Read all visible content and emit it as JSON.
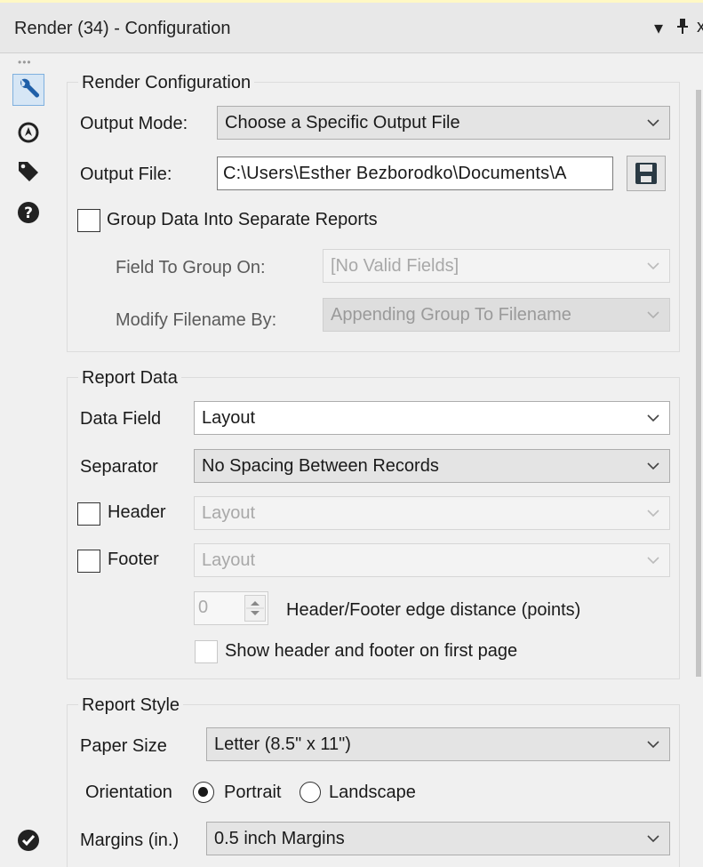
{
  "window": {
    "title": "Render (34) - Configuration",
    "pin_glyph": "▾ ⊥"
  },
  "tools": [
    {
      "icon": "wrench-icon",
      "active": true
    },
    {
      "icon": "compass-icon",
      "active": false
    },
    {
      "icon": "tag-icon",
      "active": false
    },
    {
      "icon": "help-icon",
      "active": false
    }
  ],
  "render_config": {
    "title": "Render Configuration",
    "output_mode_label": "Output Mode:",
    "output_mode_value": "Choose a Specific Output File",
    "output_file_label": "Output File:",
    "output_file_value": "C:\\Users\\Esther Bezborodko\\Documents\\A",
    "group_data_label": "Group Data Into Separate Reports",
    "field_to_group_label": "Field To Group On:",
    "field_to_group_value": "[No Valid Fields]",
    "modify_filename_label": "Modify Filename By:",
    "modify_filename_value": "Appending Group To Filename"
  },
  "report_data": {
    "title": "Report Data",
    "data_field_label": "Data Field",
    "data_field_value": "Layout",
    "separator_label": "Separator",
    "separator_value": "No Spacing Between Records",
    "header_label": "Header",
    "header_value": "Layout",
    "footer_label": "Footer",
    "footer_value": "Layout",
    "edge_distance_value": "0",
    "edge_distance_label": "Header/Footer edge distance (points)",
    "show_first_page_label": "Show header and footer on first page"
  },
  "report_style": {
    "title": "Report Style",
    "paper_size_label": "Paper Size",
    "paper_size_value": "Letter (8.5\" x 11\")",
    "orientation_label": "Orientation",
    "portrait_label": "Portrait",
    "landscape_label": "Landscape",
    "orientation_selected": "Portrait",
    "margins_label": "Margins (in.)",
    "margins_value": "0.5 inch Margins"
  },
  "colors": {
    "accent": "#1f5fa8",
    "panel_bg": "#f0f0f0"
  }
}
